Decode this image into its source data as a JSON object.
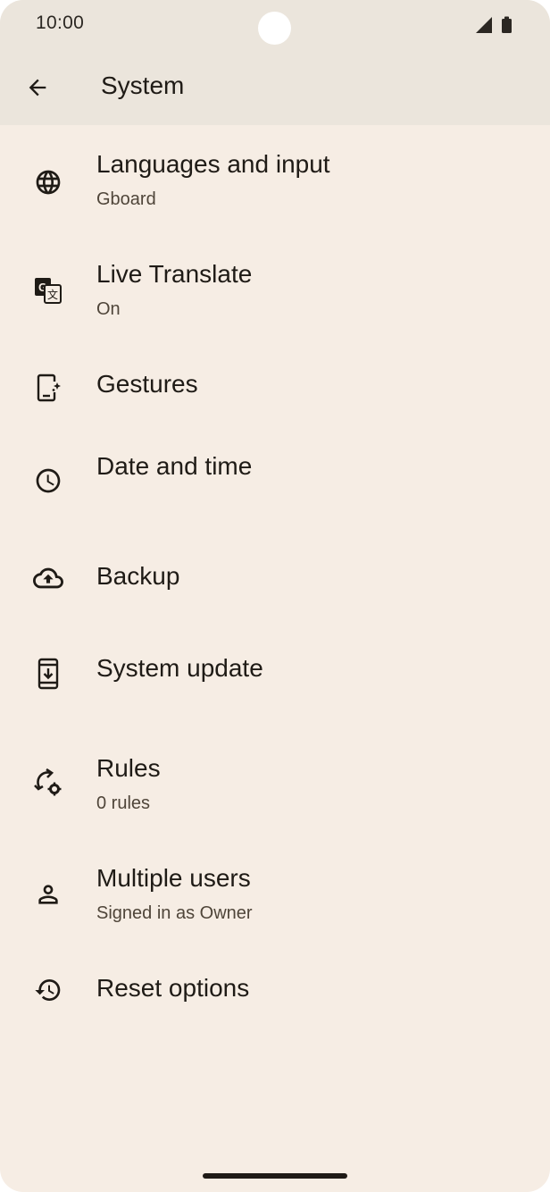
{
  "status_bar": {
    "time": "10:00",
    "signal_icon": "cellular-signal-icon",
    "battery_icon": "battery-icon"
  },
  "header": {
    "back_icon": "arrow-back-icon",
    "title": "System"
  },
  "items": [
    {
      "icon": "globe-icon",
      "title": "Languages and input",
      "subtitle": "Gboard"
    },
    {
      "icon": "translate-icon",
      "title": "Live Translate",
      "subtitle": "On"
    },
    {
      "icon": "gesture-phone-icon",
      "title": "Gestures",
      "subtitle": ""
    },
    {
      "icon": "clock-icon",
      "title": "Date and time",
      "subtitle": ""
    },
    {
      "icon": "cloud-upload-icon",
      "title": "Backup",
      "subtitle": ""
    },
    {
      "icon": "system-update-icon",
      "title": "System update",
      "subtitle": ""
    },
    {
      "icon": "rules-icon",
      "title": "Rules",
      "subtitle": "0 rules"
    },
    {
      "icon": "person-icon",
      "title": "Multiple users",
      "subtitle": "Signed in as Owner"
    },
    {
      "icon": "history-icon",
      "title": "Reset options",
      "subtitle": ""
    }
  ],
  "colors": {
    "background": "#f6ede4",
    "header_background": "#ebe5dc",
    "text_primary": "#1f1b16",
    "text_secondary": "#4f4539"
  }
}
